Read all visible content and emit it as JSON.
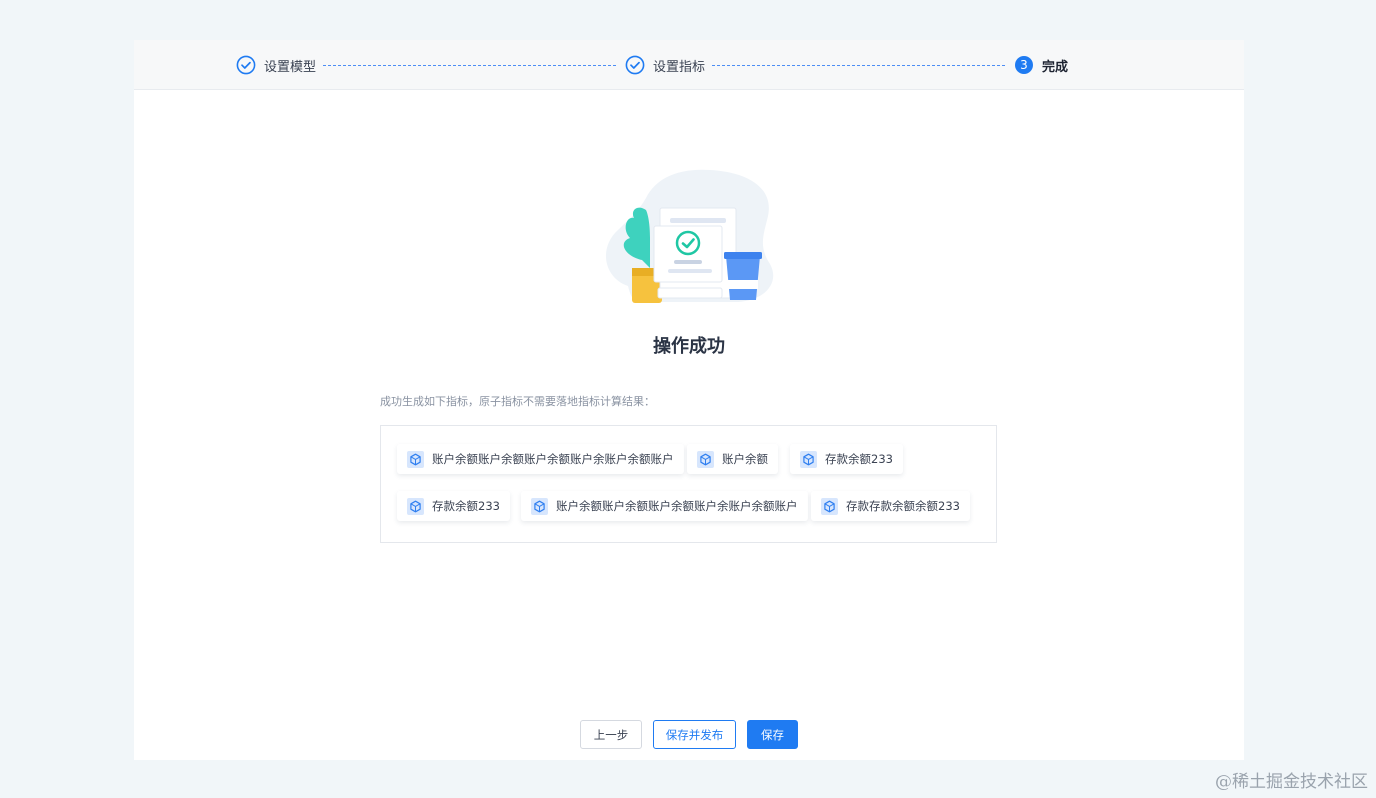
{
  "steps": [
    {
      "label": "设置模型",
      "status": "done"
    },
    {
      "label": "设置指标",
      "status": "done"
    },
    {
      "label": "完成",
      "number": "3",
      "status": "active"
    }
  ],
  "result": {
    "title": "操作成功",
    "description": "成功生成如下指标，原子指标不需要落地指标计算结果："
  },
  "metrics": [
    {
      "label": "账户余额账户余额账户余额账户余账户余额账户",
      "icon": "metric-cube-icon"
    },
    {
      "label": "账户余额",
      "icon": "metric-cube-icon"
    },
    {
      "label": "存款余额233",
      "icon": "metric-cube-icon"
    },
    {
      "label": "存款余额233",
      "icon": "metric-cube-icon"
    },
    {
      "label": "账户余额账户余额账户余额账户余账户余额账户",
      "icon": "metric-cube-icon"
    },
    {
      "label": "存款存款余额余额233",
      "icon": "metric-cube-icon"
    }
  ],
  "actions": {
    "prev": "上一步",
    "save_publish": "保存并发布",
    "save": "保存"
  },
  "watermark": "@稀土掘金技术社区",
  "colors": {
    "primary": "#1f7bf2",
    "page_bg": "#f1f6f9",
    "success": "#1fc7a4"
  }
}
